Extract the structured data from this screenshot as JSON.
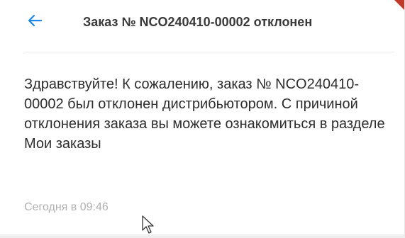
{
  "header": {
    "back_icon": "arrow-left-icon",
    "title": "Заказ № NCO240410-00002 отклонен",
    "accent_color": "#1e88e5"
  },
  "message": {
    "body": "Здравствуйте! К сожалению, заказ № NCO240410-00002 был отклонен дистрибьютором. С причиной отклонения заказа вы можете ознакомиться в разделе Мои заказы",
    "timestamp": "Сегодня в 09:46"
  },
  "colors": {
    "corner_accent": "#c0392b",
    "text": "#2d2d2d",
    "timestamp": "#b0b0b0"
  },
  "cursor_icon": "mouse-pointer-icon"
}
